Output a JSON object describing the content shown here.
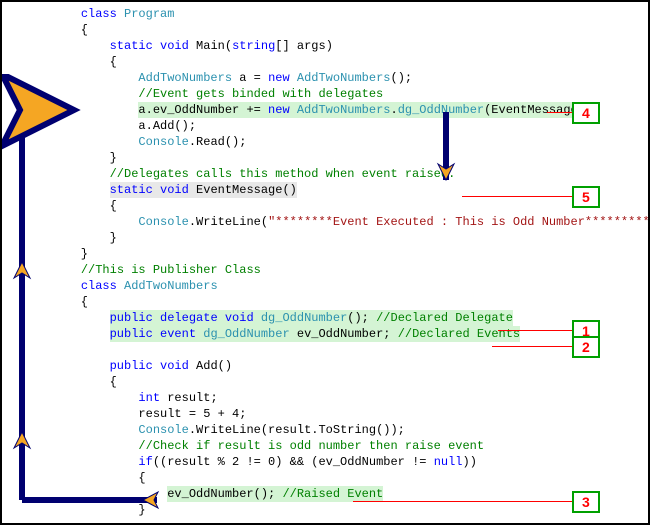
{
  "code": {
    "l1_a": "class",
    "l1_b": " Program",
    "l2": "    {",
    "l3_a": "static",
    "l3_b": " void",
    "l3_c": " Main(",
    "l3_d": "string",
    "l3_e": "[] args)",
    "l4": "        {",
    "l5_a": "AddTwoNumbers",
    "l5_b": " a = ",
    "l5_c": "new",
    "l5_d": " AddTwoNumbers",
    "l5_e": "();",
    "l6": "//Event gets binded with delegates",
    "l7_a": "a.ev_OddNumber += ",
    "l7_b": "new",
    "l7_c": " AddTwoNumbers",
    "l7_d": ".",
    "l7_e": "dg_OddNumber",
    "l7_f": "(EventMessage);",
    "l8": "a.Add();",
    "l9_a": "Console",
    "l9_b": ".Read();",
    "l10": "        }",
    "l11": "//Delegates calls this method when event raised.",
    "l12_a": "static",
    "l12_b": " void",
    "l12_c": " EventMessage()",
    "l13": "        {",
    "l14_a": "Console",
    "l14_b": ".WriteLine(",
    "l14_c": "\"********Event Executed : This is Odd Number**********\"",
    "l14_d": ");",
    "l15": "        }",
    "l16": "    }",
    "l17": "//This is Publisher Class",
    "l18_a": "class",
    "l18_b": " AddTwoNumbers",
    "l19": "    {",
    "l20_a": "public",
    "l20_b": " delegate",
    "l20_c": " void",
    "l20_d": " dg_OddNumber",
    "l20_e": "(); ",
    "l20_f": "//Declared Delegate",
    "l21_a": "public",
    "l21_b": " event",
    "l21_c": " dg_OddNumber",
    "l21_d": " ev_OddNumber; ",
    "l21_e": "//Declared Events",
    "l22_a": "public",
    "l22_b": " void",
    "l22_c": " Add()",
    "l23": "        {",
    "l24_a": "int",
    "l24_b": " result;",
    "l25": "result = 5 + 4;",
    "l26_a": "Console",
    "l26_b": ".WriteLine(result.ToString());",
    "l27": "//Check if result is odd number then raise event",
    "l28_a": "if",
    "l28_b": "((result % 2 != 0) && (ev_OddNumber != ",
    "l28_c": "null",
    "l28_d": "))",
    "l29": "            {",
    "l30_a": "ev_OddNumber(); ",
    "l30_b": "//Raised Event",
    "l31": "            }"
  },
  "callouts": {
    "c1": "1",
    "c2": "2",
    "c3": "3",
    "c4": "4",
    "c5": "5"
  }
}
